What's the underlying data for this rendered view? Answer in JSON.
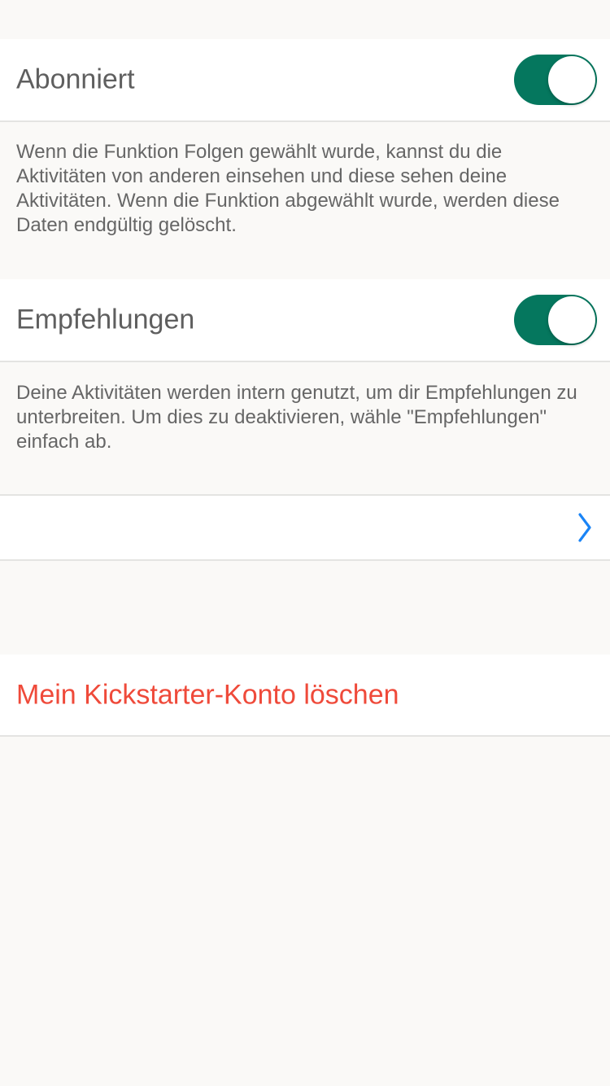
{
  "colors": {
    "background": "#faf9f7",
    "toggle_on": "#05775e",
    "link_blue": "#1a84f6",
    "danger_red": "#ef4a3a"
  },
  "settings": {
    "followed": {
      "label": "Abonniert",
      "enabled": true,
      "description": "Wenn die Funktion Folgen gewählt wurde, kannst du die Aktivitäten von anderen einsehen und diese sehen deine Aktivitäten. Wenn die Funktion abgewählt wurde, werden diese Daten endgültig gelöscht."
    },
    "recommendations": {
      "label": "Empfehlungen",
      "enabled": true,
      "description": "Deine Aktivitäten werden intern genutzt, um dir Empfehlungen zu unterbreiten. Um dies zu deaktivieren, wähle \"Empfehlungen\" einfach ab."
    },
    "navigation_row": {
      "label": "",
      "icon": "chevron-right-icon"
    },
    "delete_account": {
      "label": "Mein Kickstarter-Konto löschen"
    }
  }
}
